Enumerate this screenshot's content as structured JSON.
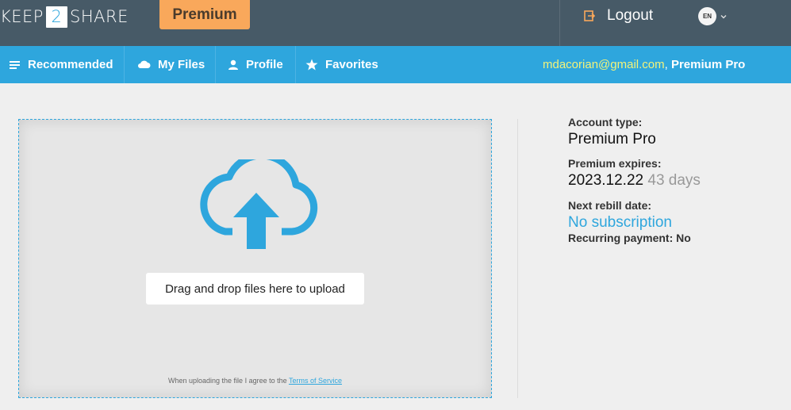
{
  "header": {
    "logo_left": "KEEP",
    "logo_mid": "2",
    "logo_right": "SHARE",
    "premium_label": "Premium",
    "logout_label": "Logout",
    "lang_code": "EN"
  },
  "nav": {
    "items": [
      {
        "label": "Recommended",
        "icon": "list-icon"
      },
      {
        "label": "My Files",
        "icon": "cloud-icon"
      },
      {
        "label": "Profile",
        "icon": "user-icon"
      },
      {
        "label": "Favorites",
        "icon": "star-icon"
      }
    ],
    "email": "mdacorian@gmail.com",
    "comma": ", ",
    "plan": "Premium Pro"
  },
  "upload": {
    "button_label": "Drag and drop files here to upload",
    "terms_prefix": "When uploading the file I agree to the ",
    "terms_link": "Terms of Service"
  },
  "account": {
    "type_label": "Account type:",
    "type_value": "Premium Pro",
    "expires_label": "Premium expires:",
    "expires_date": "2023.12.22",
    "expires_days": "43 days",
    "rebill_label": "Next rebill date:",
    "rebill_value": "No subscription",
    "recurring_label": "Recurring payment:",
    "recurring_value": "No"
  },
  "colors": {
    "header_bg": "#475a67",
    "nav_bg": "#2ea6dd",
    "premium_bg": "#f9a85b",
    "email_color": "#f3f37a"
  }
}
